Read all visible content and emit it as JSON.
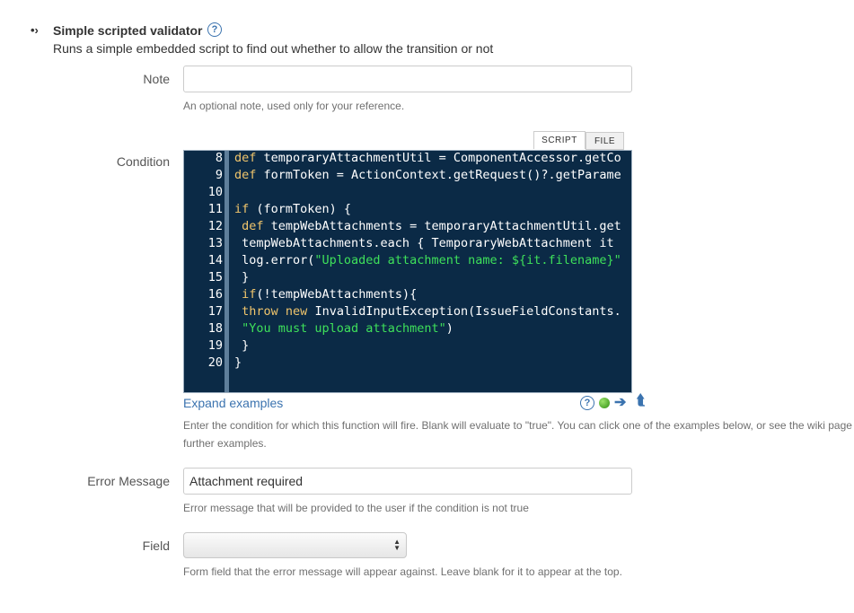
{
  "header": {
    "bullet": "•›",
    "title": "Simple scripted validator",
    "help_glyph": "?",
    "description": "Runs a simple embedded script to find out whether to allow the transition or not"
  },
  "note_field": {
    "label": "Note",
    "value": "",
    "hint": "An optional note, used only for your reference."
  },
  "condition_field": {
    "label": "Condition",
    "tabs": [
      {
        "label": "SCRIPT",
        "active": true
      },
      {
        "label": "FILE",
        "active": false
      }
    ],
    "code_lines": [
      {
        "num": "8",
        "text": "def temporaryAttachmentUtil = ComponentAccessor.getCo"
      },
      {
        "num": "9",
        "text": "def formToken = ActionContext.getRequest()?.getParame"
      },
      {
        "num": "10",
        "text": ""
      },
      {
        "num": "11",
        "text": "if (formToken) {"
      },
      {
        "num": "12",
        "text": " def tempWebAttachments = temporaryAttachmentUtil.get"
      },
      {
        "num": "13",
        "text": " tempWebAttachments.each { TemporaryWebAttachment it"
      },
      {
        "num": "14",
        "text": " log.error(\"Uploaded attachment name: ${it.filename}\""
      },
      {
        "num": "15",
        "text": " }"
      },
      {
        "num": "16",
        "text": " if(!tempWebAttachments){"
      },
      {
        "num": "17",
        "text": " throw new InvalidInputException(IssueFieldConstants."
      },
      {
        "num": "18",
        "text": " \"You must upload attachment\")"
      },
      {
        "num": "19",
        "text": " }"
      },
      {
        "num": "20",
        "text": "}"
      }
    ],
    "expand_link": "Expand examples",
    "toolbar_icons": [
      "help-icon",
      "status-ok-icon",
      "arrow-right-icon",
      "arrow-up-icon"
    ],
    "hint_line1": "Enter the condition for which this function will fire. Blank will evaluate to \"true\". You can click one of the examples below, or see the wiki page",
    "hint_line2": "further examples."
  },
  "error_field": {
    "label": "Error Message",
    "value": "Attachment required",
    "hint": "Error message that will be provided to the user if the condition is not true"
  },
  "field_select": {
    "label": "Field",
    "selected": "",
    "hint": "Form field that the error message will appear against. Leave blank for it to appear at the top."
  },
  "colors": {
    "link": "#3b73af",
    "editor_bg": "#0b2a46",
    "keyword": "#f0c56c",
    "string": "#3ee05a"
  }
}
